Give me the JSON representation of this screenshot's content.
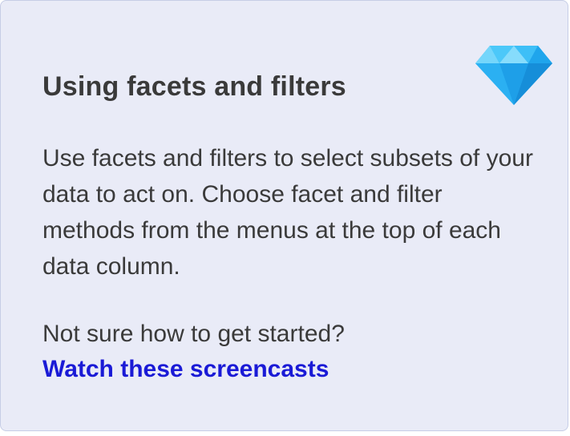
{
  "card": {
    "title": "Using facets and filters",
    "description": "Use facets and filters to select subsets of your data to act on. Choose facet and filter methods from the menus at the top of each data column.",
    "prompt": "Not sure how to get started?",
    "link_label": "Watch these screencasts"
  },
  "icons": {
    "gem": "diamond-icon"
  },
  "colors": {
    "panel_background": "#e9ebf7",
    "panel_border": "#c6cde6",
    "text": "#3a3a3a",
    "link": "#1a1ad6",
    "gem": "#2fb6f5"
  }
}
